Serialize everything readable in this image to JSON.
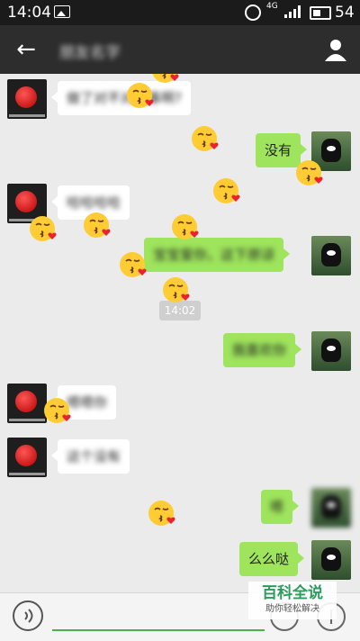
{
  "status_bar": {
    "time": "14:04",
    "network": "4G",
    "battery": "54",
    "icons": [
      "image-icon",
      "alarm-icon",
      "signal-icon",
      "battery-icon"
    ]
  },
  "header": {
    "title": "朋友名字",
    "back_icon": "arrow-left-icon",
    "profile_icon": "person-icon"
  },
  "chat": {
    "timestamp": "14:02",
    "messages": [
      {
        "side": "left",
        "avatar": "apple-avatar",
        "text": "做了对不对的事啊?",
        "blurred": true
      },
      {
        "side": "right",
        "avatar": "bear-avatar",
        "text": "没有",
        "blurred": false
      },
      {
        "side": "left",
        "avatar": "apple-avatar",
        "text": "哈哈哈哈",
        "blurred": true
      },
      {
        "side": "right",
        "avatar": "bear-avatar",
        "text": "宝宝爱你，这下原谅",
        "blurred": true
      },
      {
        "side": "right",
        "avatar": "bear-avatar",
        "text": "我喜欢你",
        "blurred": true
      },
      {
        "side": "left",
        "avatar": "apple-avatar",
        "text": "嗯嗯你",
        "blurred": true
      },
      {
        "side": "left",
        "avatar": "apple-avatar",
        "text": "这个没有",
        "blurred": true
      },
      {
        "side": "right",
        "avatar": "bear-avatar",
        "text": "嗯",
        "blurred": true
      },
      {
        "side": "right",
        "avatar": "bear-avatar",
        "text": "么么哒",
        "blurred": false
      }
    ],
    "emoji": "kiss-emoji"
  },
  "watermark": {
    "title": "百科全说",
    "subtitle": "助你轻松解决"
  },
  "colors": {
    "status_bar": "#1b1b1b",
    "title_bar": "#2d2d2d",
    "chat_bg": "#ebebeb",
    "bubble_right": "#9ee45c",
    "bubble_left": "#ffffff",
    "input_underline": "#4caf50"
  },
  "bottom_bar": {
    "voice_icon": "voice-icon",
    "emoji_icon": "emoji-button-icon",
    "plus_icon": "plus-icon"
  }
}
